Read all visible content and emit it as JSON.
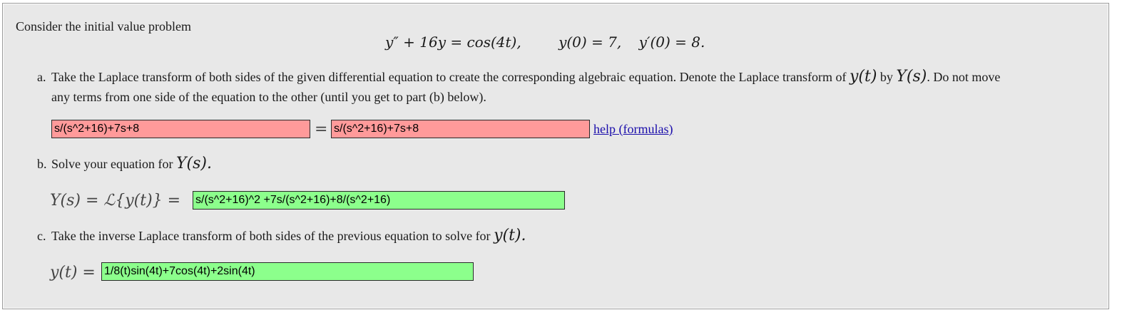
{
  "intro": "Consider the initial value problem",
  "ivp": {
    "ode_left": "y″ + 16y = cos(4t),",
    "ic1": "y(0) = 7,",
    "ic2": "y′(0) = 8."
  },
  "part_a": {
    "marker": "a.",
    "text_1": "Take the Laplace transform of both sides of the given differential equation to create the corresponding algebraic equation. Denote the Laplace transform of",
    "y_of_t": "y(t)",
    "by": "by",
    "Y_of_s": "Y(s)",
    "text_2": ". Do not move",
    "text_3": "any terms from one side of the equation to the other (until you get to part (b) below).",
    "lhs_value": "s/(s^2+16)+7s+8",
    "equals": "=",
    "rhs_value": "s/(s^2+16)+7s+8",
    "help_link": "help (formulas)"
  },
  "part_b": {
    "marker": "b.",
    "text": "Solve your equation for",
    "Y_of_s": "Y(s).",
    "lhs_math": "Y(s) = ℒ{y(t)} =",
    "answer_value": "s/(s^2+16)^2 +7s/(s^2+16)+8/(s^2+16)"
  },
  "part_c": {
    "marker": "c.",
    "text": "Take the inverse Laplace transform of both sides of the previous equation to solve for",
    "y_of_t": "y(t).",
    "lhs_math": "y(t) =",
    "answer_value": "1/8(t)sin(4t)+7cos(4t)+2sin(4t)"
  },
  "colors": {
    "incorrect": "#ff9a9a",
    "correct": "#8cff8c",
    "panel": "#e8e8e8",
    "link": "#1a0dab"
  }
}
